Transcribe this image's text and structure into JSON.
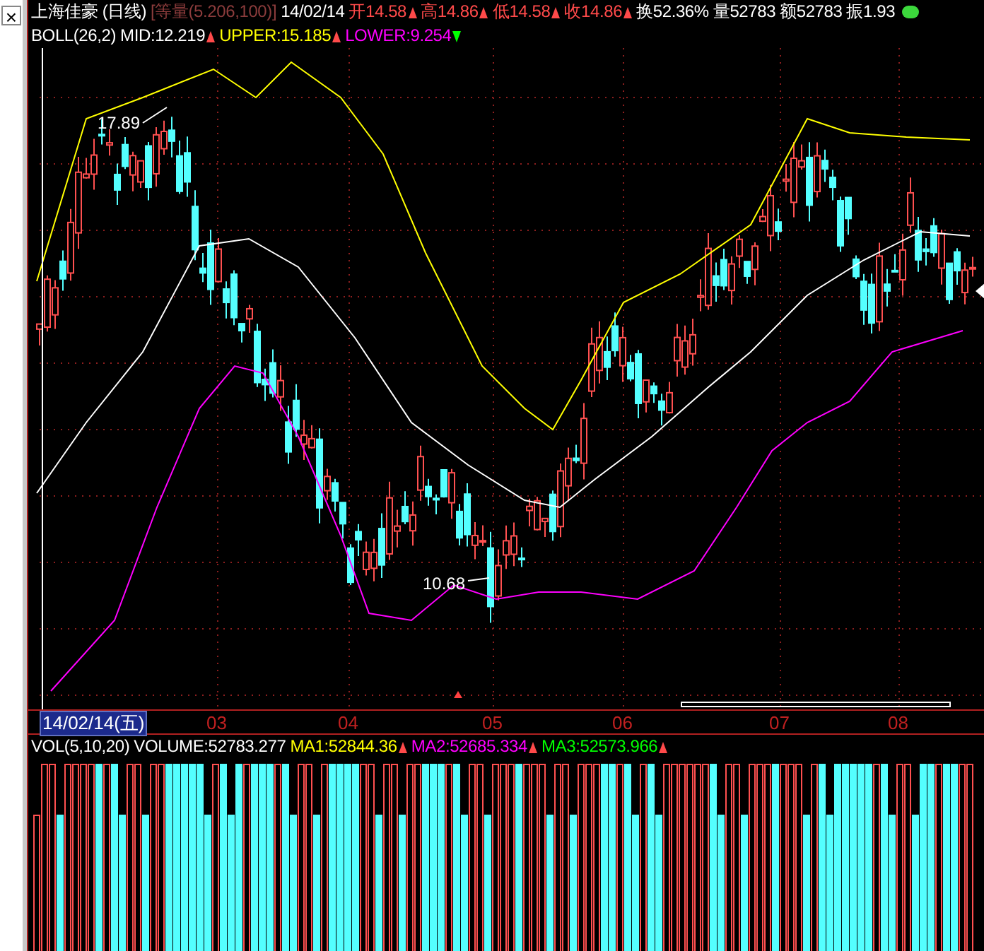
{
  "close_button": "×",
  "header": {
    "items": [
      {
        "text": "上海佳豪 (日线)",
        "color": "#ffffff",
        "kind": "plain"
      },
      {
        "text": "[等量(5.206,100)]",
        "color": "#8c3c3c",
        "kind": "plain"
      },
      {
        "text": "14/02/14",
        "color": "#ffffff",
        "kind": "plain"
      },
      {
        "text": "开14.58",
        "color": "#ff4a4a",
        "kind": "rising"
      },
      {
        "text": "高14.86",
        "color": "#ff4a4a",
        "kind": "rising"
      },
      {
        "text": "低14.58",
        "color": "#ff4a4a",
        "kind": "rising"
      },
      {
        "text": "收14.86",
        "color": "#ff4a4a",
        "kind": "rising"
      },
      {
        "text": "换52.36%",
        "color": "#ffffff",
        "kind": "plain"
      },
      {
        "text": "量52783",
        "color": "#ffffff",
        "kind": "plain"
      },
      {
        "text": "额52783",
        "color": "#ffffff",
        "kind": "plain"
      },
      {
        "text": "振1.93",
        "color": "#ffffff",
        "kind": "plain"
      }
    ]
  },
  "indicator": {
    "items": [
      {
        "text": "BOLL(26,2)",
        "color": "#ffffff",
        "kind": "plain"
      },
      {
        "text": "MID:12.219",
        "color": "#ffffff",
        "kind": "rising"
      },
      {
        "text": "UPPER:15.185",
        "color": "#ffff00",
        "kind": "rising"
      },
      {
        "text": "LOWER:9.254",
        "color": "#ff00ff",
        "kind": "falling"
      }
    ]
  },
  "chart": {
    "high_label": "17.89",
    "low_label": "10.68"
  },
  "axis": {
    "cursor_date": "14/02/14(五)",
    "months": [
      "03",
      "04",
      "05",
      "06",
      "07",
      "08"
    ]
  },
  "volume": {
    "items": [
      {
        "text": "VOL(5,10,20)",
        "color": "#ffffff",
        "kind": "plain"
      },
      {
        "text": "VOLUME:52783.277",
        "color": "#ffffff",
        "kind": "plain"
      },
      {
        "text": "MA1:52844.36",
        "color": "#ffff00",
        "kind": "rising"
      },
      {
        "text": "MA2:52685.334",
        "color": "#ff00ff",
        "kind": "rising"
      },
      {
        "text": "MA3:52573.966",
        "color": "#00ff00",
        "kind": "rising"
      }
    ]
  }
}
